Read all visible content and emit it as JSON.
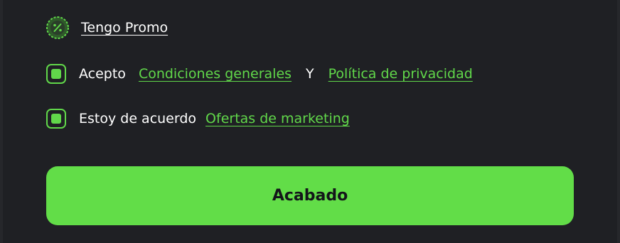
{
  "promo": {
    "icon": "percent-badge-icon",
    "label": "Tengo Promo"
  },
  "terms": {
    "checked": true,
    "prefix": "Acepto",
    "link_general": "Condiciones generales",
    "conjunction": "Y",
    "link_privacy": "Política de privacidad"
  },
  "marketing": {
    "checked": true,
    "prefix": "Estoy de acuerdo",
    "link": "Ofertas de marketing"
  },
  "submit": {
    "label": "Acabado"
  },
  "colors": {
    "accent": "#61d84a",
    "background": "#1f2024",
    "button_text": "#14161a"
  }
}
